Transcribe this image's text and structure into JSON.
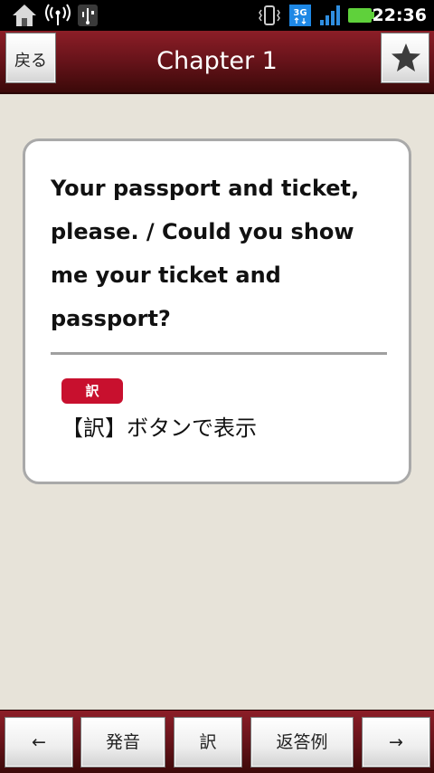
{
  "status_bar": {
    "time": "22:36",
    "network_type": "3G",
    "icons": [
      "home-icon",
      "wifi-hotspot-icon",
      "usb-icon",
      "vibrate-icon",
      "network-3g-icon",
      "signal-icon",
      "battery-icon"
    ],
    "battery_color": "#5fd13b"
  },
  "header": {
    "back_label": "戻る",
    "title": "Chapter 1",
    "favorite_icon": "star-icon"
  },
  "card": {
    "phrase": "Your passport and ticket, please. / Could you show me your ticket and passport?",
    "translation_badge": "訳",
    "translation_placeholder": "【訳】ボタンで表示"
  },
  "toolbar": {
    "prev_label": "←",
    "pronounce_label": "発音",
    "translate_label": "訳",
    "reply_example_label": "返答例",
    "next_label": "→"
  },
  "colors": {
    "accent": "#7a1a22",
    "badge": "#c8102e",
    "background": "#e7e3d9"
  }
}
